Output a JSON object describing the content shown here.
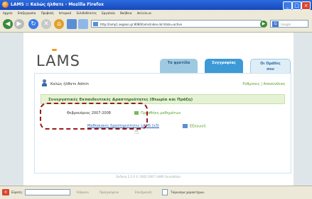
{
  "window": {
    "title": "LAMS :: Καλώς ήλθατε - Mozilla Firefox"
  },
  "menubar": {
    "items": [
      "Αρχείο",
      "Επεξεργασία",
      "Προβολή",
      "Ιστορικό",
      "Σελιδοδείκτες",
      "Εργαλεία",
      "Βοήθεια",
      "del.icio.us"
    ]
  },
  "navbar": {
    "url": "http://lamp1.aegean.gr:8080/lams/index.do?state=active",
    "search_placeholder": "Google"
  },
  "page": {
    "logo": "LAMS",
    "tabs": [
      {
        "label": "Τα φροτίδα",
        "sub": ""
      },
      {
        "label": "Συγγραφέας",
        "sub": ""
      },
      {
        "label": "Οι Ομάδες",
        "sub": "σου"
      }
    ],
    "welcome": "Καλώς ήλθατε Admin",
    "toplinks": "Ρυθμίσεις | Αποσύνδεση",
    "course_title": "Συνεργατικές Εκπαιδευτικές Δραστηριότητες (Θεωρία και Πράξη)",
    "date": "Φεβρουάριος 2007-2008",
    "progress_link": "Προσθήκη μαθημάτων",
    "activity_link": "Μαθησιακές δραστηριότητες LAMS (x3)",
    "export_link": "Εξαγωγή",
    "footer": "Έκδοση 2.1.0 © 2002-2007 LAMS Foundation"
  },
  "statusbar": {
    "find_label": "Εύρεση:",
    "next": "Επόμενο",
    "prev": "Προηγούμενο",
    "highlight": "Επισήμανση",
    "match_case": "Ταίριασμα χαρακτήρων"
  }
}
